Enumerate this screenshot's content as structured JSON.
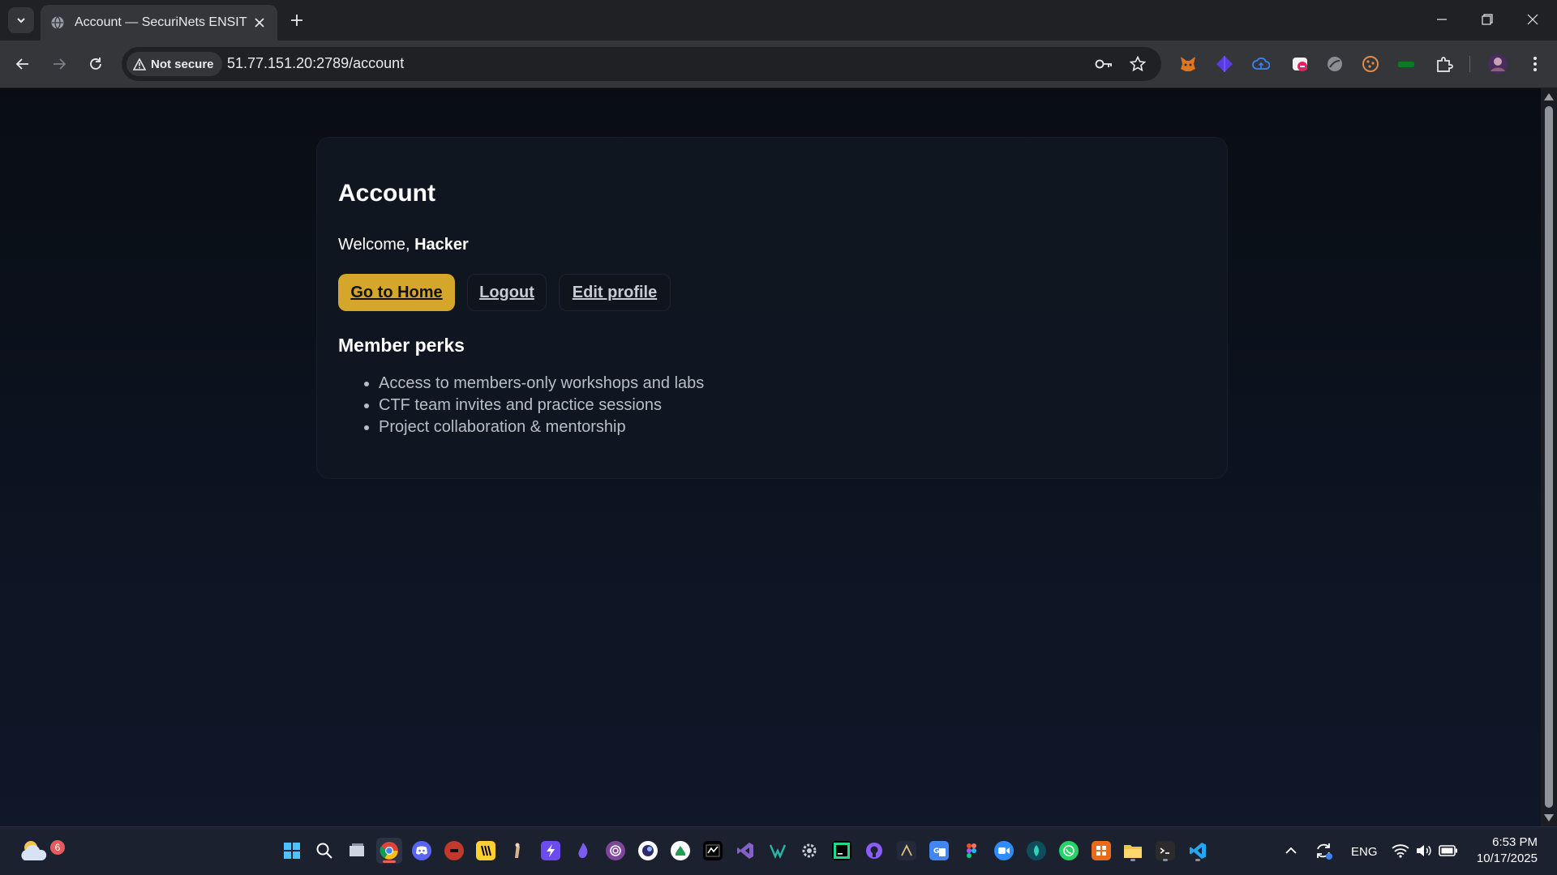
{
  "browser": {
    "tab_title": "Account — SecuriNets ENSIT",
    "security_chip": "Not secure",
    "url": "51.77.151.20:2789/account"
  },
  "page": {
    "heading": "Account",
    "welcome_prefix": "Welcome, ",
    "username": "Hacker",
    "buttons": {
      "home": "Go to Home",
      "logout": "Logout",
      "edit": "Edit profile"
    },
    "perks_heading": "Member perks",
    "perks": [
      "Access to members-only workshops and labs",
      "CTF team invites and practice sessions",
      "Project collaboration & mentorship"
    ]
  },
  "taskbar": {
    "weather_badge": "6",
    "language": "ENG",
    "time": "6:53 PM",
    "date": "10/17/2025",
    "apps": [
      "start",
      "search",
      "task-view",
      "chrome",
      "discord",
      "app-red",
      "miro",
      "app-figure",
      "obsidian-bolt",
      "app-purple-flame",
      "tor",
      "app-dark-circle",
      "app-green",
      "terminal-app",
      "visual-studio",
      "vs-alt",
      "settings-app",
      "pycharm",
      "github",
      "app-dark",
      "translate",
      "figma",
      "zoom",
      "app-teal",
      "whatsapp",
      "office",
      "file-explorer",
      "windows-terminal",
      "vscode"
    ]
  },
  "colors": {
    "accent": "#d4a62a",
    "card_bg": "#121822",
    "page_bg": "#0a0f18"
  }
}
